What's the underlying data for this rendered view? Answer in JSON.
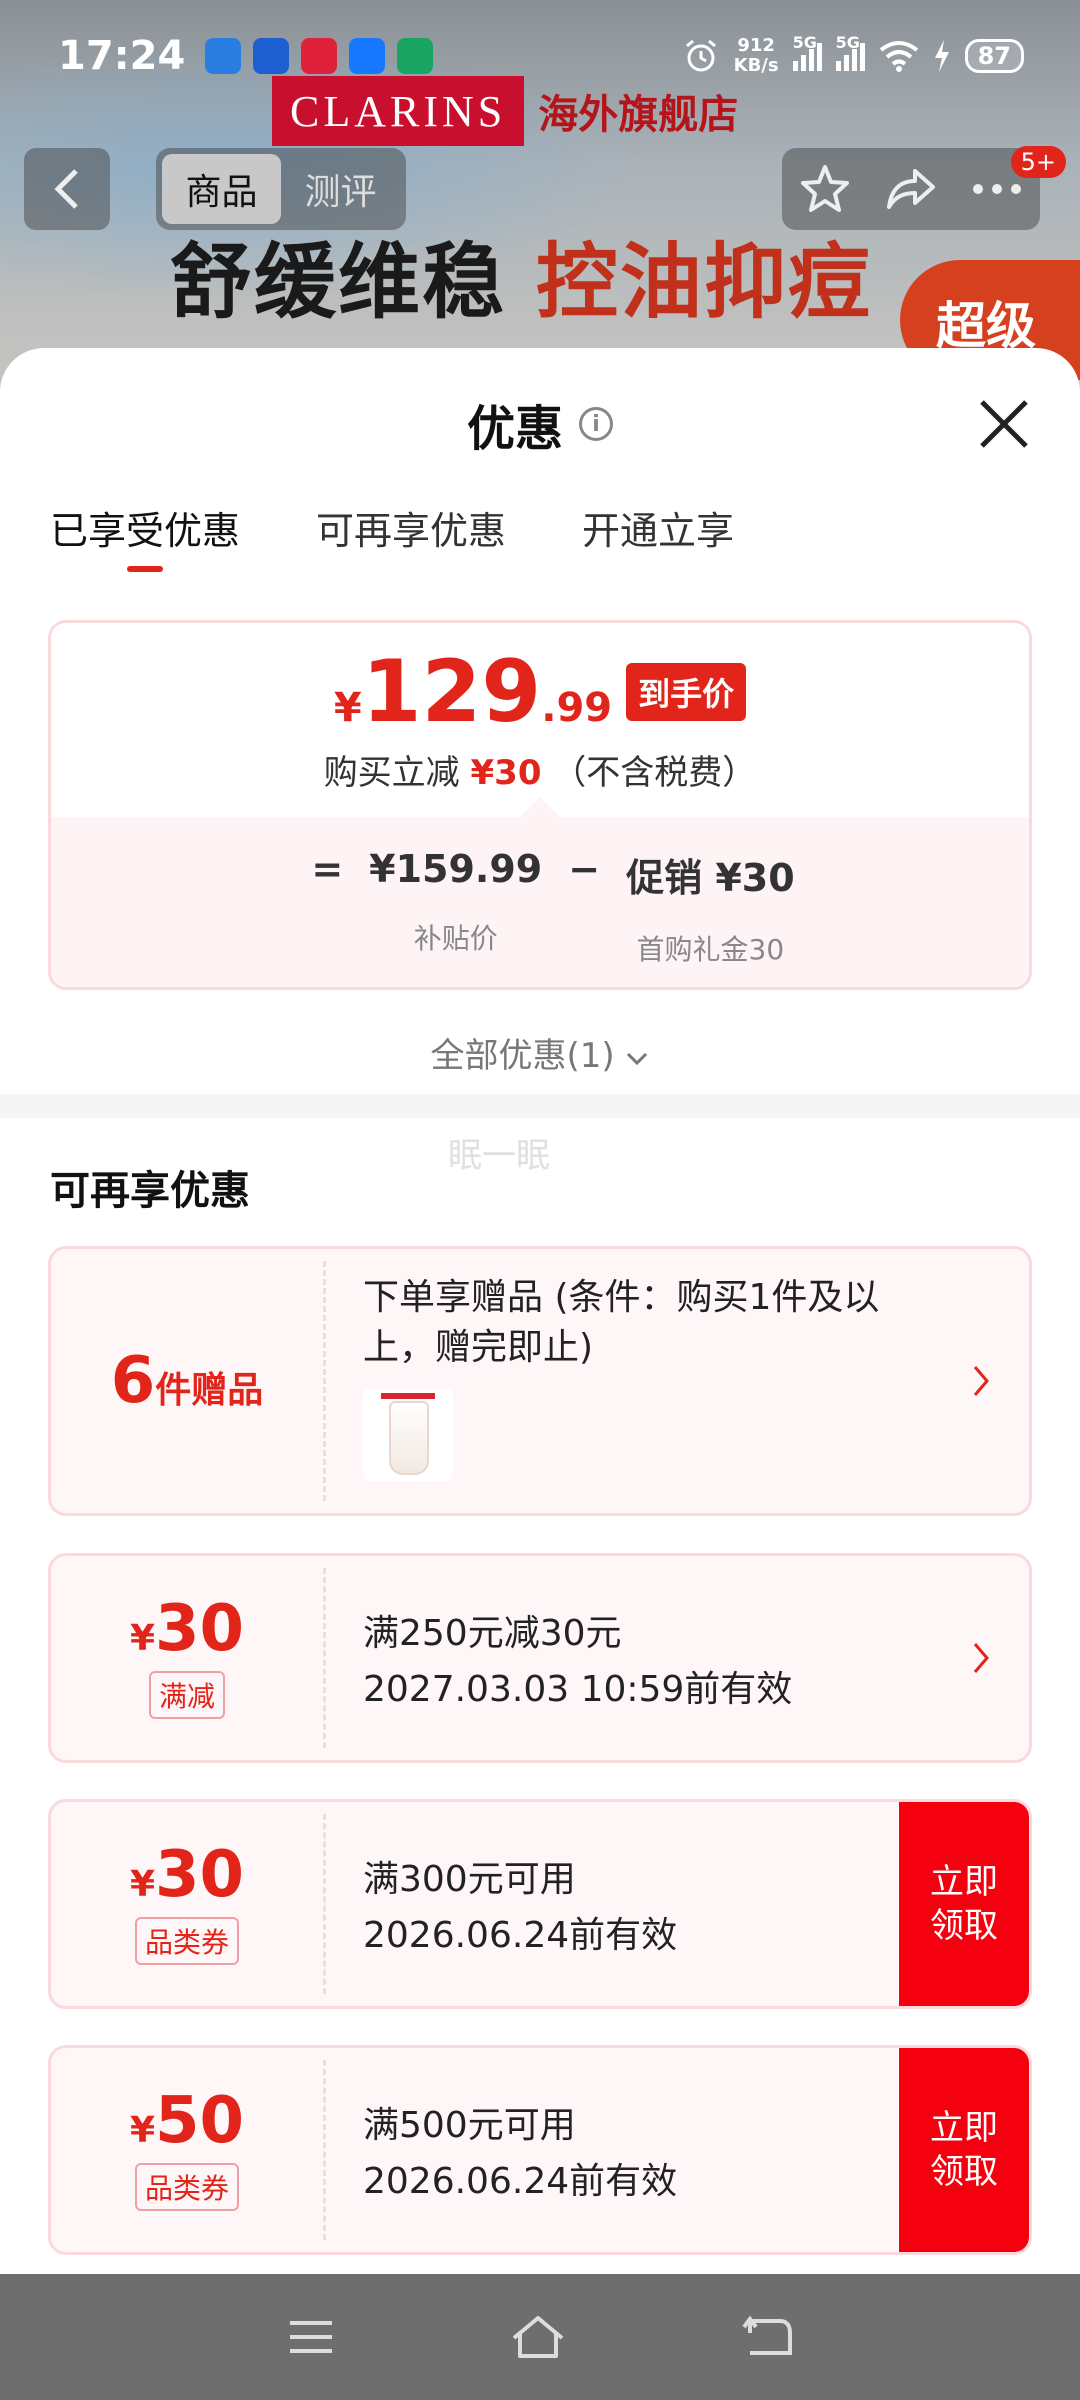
{
  "status_bar": {
    "time": "17:24",
    "net_speed_value": "912",
    "net_speed_unit": "KB/s",
    "sim1": "5G",
    "sim2": "5G",
    "battery": "87"
  },
  "background": {
    "brand_logo": "CLARINS",
    "store_name": "海外旗舰店",
    "headline_left": "舒缓维稳",
    "headline_right": "控油抑痘",
    "badge": "超级"
  },
  "nav": {
    "tabs": [
      "商品",
      "测评"
    ],
    "badge_count": "5+"
  },
  "sheet": {
    "title": "优惠",
    "tabs": [
      {
        "label": "已享受优惠"
      },
      {
        "label": "可再享优惠"
      },
      {
        "label": "开通立享"
      }
    ],
    "price": {
      "currency": "¥",
      "integer": "129",
      "decimal": ".99",
      "tag": "到手价",
      "note_prefix": "购买立减",
      "note_amount": "¥30",
      "note_suffix": "（不含税费）",
      "eq": "=",
      "base_value": "¥159.99",
      "base_label": "补贴价",
      "minus": "−",
      "promo_value": "促销 ¥30",
      "promo_label": "首购礼金30"
    },
    "all_promos": "全部优惠(1)",
    "watermark": "眠一眠",
    "section_title": "可再享优惠",
    "gift": {
      "count": "6",
      "count_unit": "件赠品",
      "desc": "下单享赠品 (条件：购买1件及以上，赠完即止)"
    },
    "coupons": [
      {
        "symbol": "¥",
        "amount": "30",
        "kind": "满减",
        "line1": "满250元减30元",
        "line2": "2027.03.03 10:59前有效",
        "action": ""
      },
      {
        "symbol": "¥",
        "amount": "30",
        "kind": "品类券",
        "line1": "满300元可用",
        "line2": "2026.06.24前有效",
        "action": "立即领取"
      },
      {
        "symbol": "¥",
        "amount": "50",
        "kind": "品类券",
        "line1": "满500元可用",
        "line2": "2026.06.24前有效",
        "action": "立即领取"
      }
    ]
  },
  "colors": {
    "accent": "#e1251b",
    "claim_button": "#f5000f",
    "card_border": "#fadadd"
  }
}
